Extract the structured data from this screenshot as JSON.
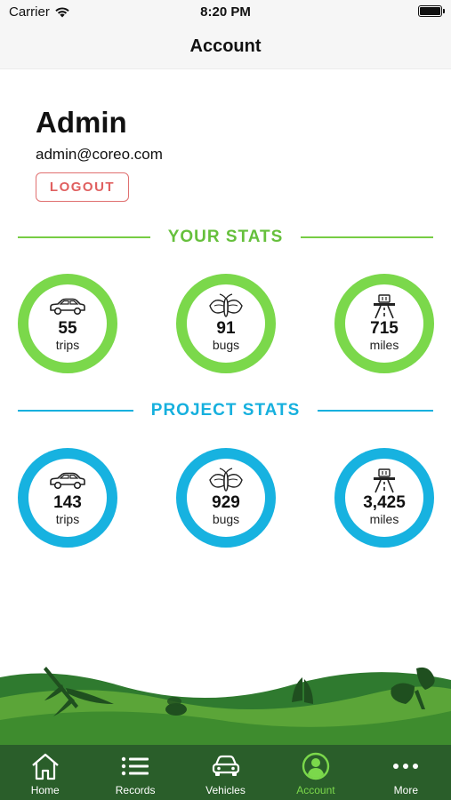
{
  "status_bar": {
    "carrier": "Carrier",
    "time": "8:20 PM"
  },
  "nav": {
    "title": "Account"
  },
  "profile": {
    "name": "Admin",
    "email": "admin@coreo.com",
    "logout_label": "LOGOUT"
  },
  "your_stats": {
    "title": "YOUR STATS",
    "color": "#7bd84b",
    "items": [
      {
        "icon": "car-icon",
        "value": "55",
        "unit": "trips"
      },
      {
        "icon": "bug-icon",
        "value": "91",
        "unit": "bugs"
      },
      {
        "icon": "road-icon",
        "value": "715",
        "unit": "miles"
      }
    ]
  },
  "project_stats": {
    "title": "PROJECT STATS",
    "color": "#17b2e0",
    "items": [
      {
        "icon": "car-icon",
        "value": "143",
        "unit": "trips"
      },
      {
        "icon": "bug-icon",
        "value": "929",
        "unit": "bugs"
      },
      {
        "icon": "road-icon",
        "value": "3,425",
        "unit": "miles"
      }
    ]
  },
  "tabs": [
    {
      "icon": "home-icon",
      "label": "Home"
    },
    {
      "icon": "list-icon",
      "label": "Records"
    },
    {
      "icon": "car-icon",
      "label": "Vehicles"
    },
    {
      "icon": "user-icon",
      "label": "Account",
      "active": true
    },
    {
      "icon": "more-icon",
      "label": "More"
    }
  ],
  "colors": {
    "tab_bar": "#2a5e2a",
    "active_tab": "#7bd84b",
    "logout": "#e06060"
  }
}
